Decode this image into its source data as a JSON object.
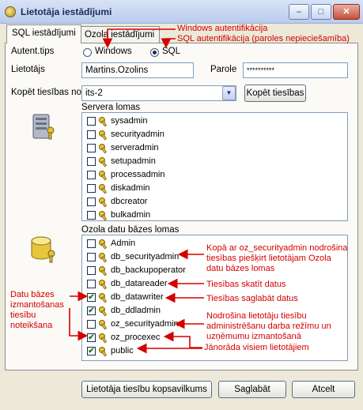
{
  "window": {
    "title": "Lietotāja iestādījumi",
    "min": "–",
    "max": "□",
    "close": "✕"
  },
  "tabs": [
    {
      "label": "SQL iestādījumi"
    },
    {
      "label": "Ozola iestādījumi"
    }
  ],
  "auth": {
    "label": "Autent.tips",
    "windows": "Windows",
    "sql": "SQL",
    "selected": "SQL"
  },
  "user": {
    "label": "Lietotājs",
    "value": "Martins.Ozolins"
  },
  "password": {
    "label": "Parole",
    "value": "**********"
  },
  "copy": {
    "label": "Kopēt tiesības no",
    "value": "its-2",
    "button": "Kopēt tiesības"
  },
  "server_roles": {
    "title": "Servera lomas",
    "items": [
      {
        "label": "sysadmin",
        "checked": false
      },
      {
        "label": "securityadmin",
        "checked": false
      },
      {
        "label": "serveradmin",
        "checked": false
      },
      {
        "label": "setupadmin",
        "checked": false
      },
      {
        "label": "processadmin",
        "checked": false
      },
      {
        "label": "diskadmin",
        "checked": false
      },
      {
        "label": "dbcreator",
        "checked": false
      },
      {
        "label": "bulkadmin",
        "checked": false
      }
    ]
  },
  "db_roles": {
    "title": "Ozola datu bāzes lomas",
    "items": [
      {
        "label": "Admin",
        "checked": false
      },
      {
        "label": "db_securityadmin",
        "checked": false
      },
      {
        "label": "db_backupoperator",
        "checked": false
      },
      {
        "label": "db_datareader",
        "checked": false
      },
      {
        "label": "db_datawriter",
        "checked": true
      },
      {
        "label": "db_ddladmin",
        "checked": true
      },
      {
        "label": "oz_securityadmin",
        "checked": false
      },
      {
        "label": "oz_procexec",
        "checked": true
      },
      {
        "label": "public",
        "checked": true
      }
    ]
  },
  "buttons": {
    "summary": "Lietotāja tiesību kopsavilkums",
    "save": "Saglabāt",
    "cancel": "Atcelt"
  },
  "annotations": {
    "windows_auth": "Windows autentifikācija",
    "sql_auth": "SQL autentifikācija (paroles nepieciešamība)",
    "security_admin": "Kopā ar oz_securityadmin nodrošina tiesības piešķirt lietotājam Ozola datu bāzes lomas",
    "read": "Tiesības skatīt datus",
    "write": "Tiesības saglabāt datus",
    "oz_security": "Nodrošina lietotāju tiesību administrēšanu darba režīmu un uzņēmumu izmantošanā",
    "all_users": "Jānorāda visiem lietotājiem",
    "left_note": "Datu bāzes izmantošanas tiesību noteikšana"
  },
  "colors": {
    "annotation": "#d40000",
    "check": "#1f7a1f"
  }
}
